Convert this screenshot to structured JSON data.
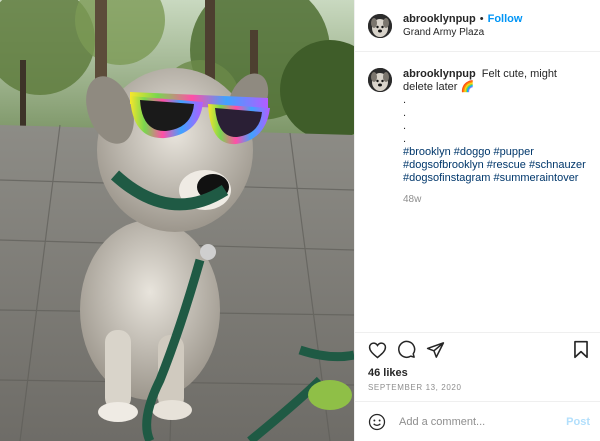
{
  "post": {
    "username": "abrooklynpup",
    "follow_label": "Follow",
    "separator": "•",
    "location": "Grand Army Plaza",
    "caption": {
      "username": "abrooklynpup",
      "text": "Felt cute, might delete later",
      "emoji": "🌈",
      "dots": [
        ".",
        ".",
        ".",
        "."
      ],
      "hashtags": [
        "#brooklyn #doggo #pupper",
        "#dogsofbrooklyn #rescue #schnauzer",
        "#dogsofinstagram #summeraintover"
      ]
    },
    "age": "48w",
    "likes": "46 likes",
    "date": "SEPTEMBER 13, 2020",
    "comment_placeholder": "Add a comment...",
    "post_label": "Post"
  },
  "icons": {
    "like": "heart-icon",
    "comment": "comment-bubble-icon",
    "share": "paper-plane-icon",
    "save": "bookmark-icon",
    "emoji": "smiley-icon"
  },
  "colors": {
    "link_blue": "#0095f6",
    "hashtag": "#00376b",
    "muted": "#8e8e8e",
    "post_disabled": "#b2dffc",
    "border": "#efefef"
  }
}
